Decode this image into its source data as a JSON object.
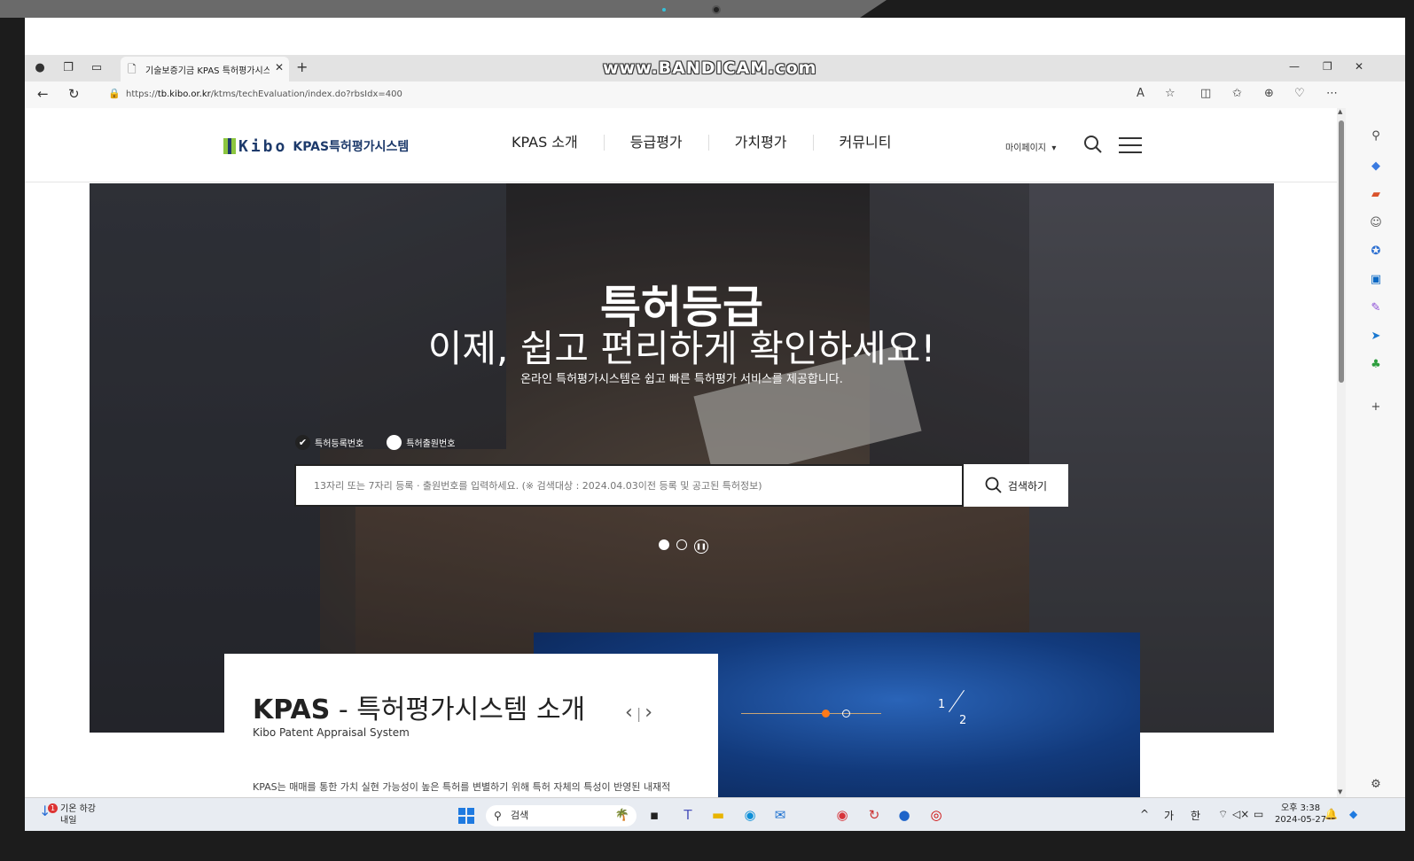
{
  "browser": {
    "tab_title": "기술보증기금 KPAS 특허평가시스",
    "watermark": "www.BANDICAM.com",
    "url_prefix": "https://",
    "url_domain": "tb.kibo.or.kr",
    "url_path": "/ktms/techEvaluation/index.do?rbsIdx=400"
  },
  "site": {
    "logo_kibo": "Kibo",
    "logo_text": "KPAS특허평가시스템",
    "nav": [
      "KPAS 소개",
      "등급평가",
      "가치평가",
      "커뮤니티"
    ],
    "mypage_label": "마이페이지"
  },
  "hero": {
    "title": "특허등급",
    "subtitle": "이제, 쉽고 편리하게 확인하세요!",
    "description": "온라인 특허평가시스템은 쉽고 빠른 특허평가 서비스를 제공합니다.",
    "radio_options": [
      {
        "label": "특허등록번호",
        "checked": true
      },
      {
        "label": "특허출원번호",
        "checked": false
      }
    ],
    "search_placeholder": "13자리 또는 7자리 등록 · 출원번호를 입력하세요. (※ 검색대상 : 2024.04.03이전 등록 및 공고된 특허정보)",
    "search_button": "검색하기",
    "slides_total": 2,
    "slide_active": 1
  },
  "intro": {
    "title_bold": "KPAS",
    "title_rest": " - 특허평가시스템 소개",
    "subtitle": "Kibo Patent Appraisal System",
    "description": "KPAS는 매매를 통한 가치 실현 가능성이 높은 특허를 변별하기 위해 특허 자체의 특성이 반영된 내재적",
    "page_current": "1",
    "page_total": "2"
  },
  "taskbar": {
    "weather_line1": "기온 하강",
    "weather_line2": "내일",
    "weather_badge": "1",
    "search_label": "검색",
    "ime1": "가",
    "ime2": "한",
    "time": "오후 3:38",
    "date": "2024-05-27"
  },
  "colors": {
    "brand_navy": "#1d3a6b",
    "brand_green": "#8cc63f",
    "slider_orange": "#ff7a1a"
  }
}
